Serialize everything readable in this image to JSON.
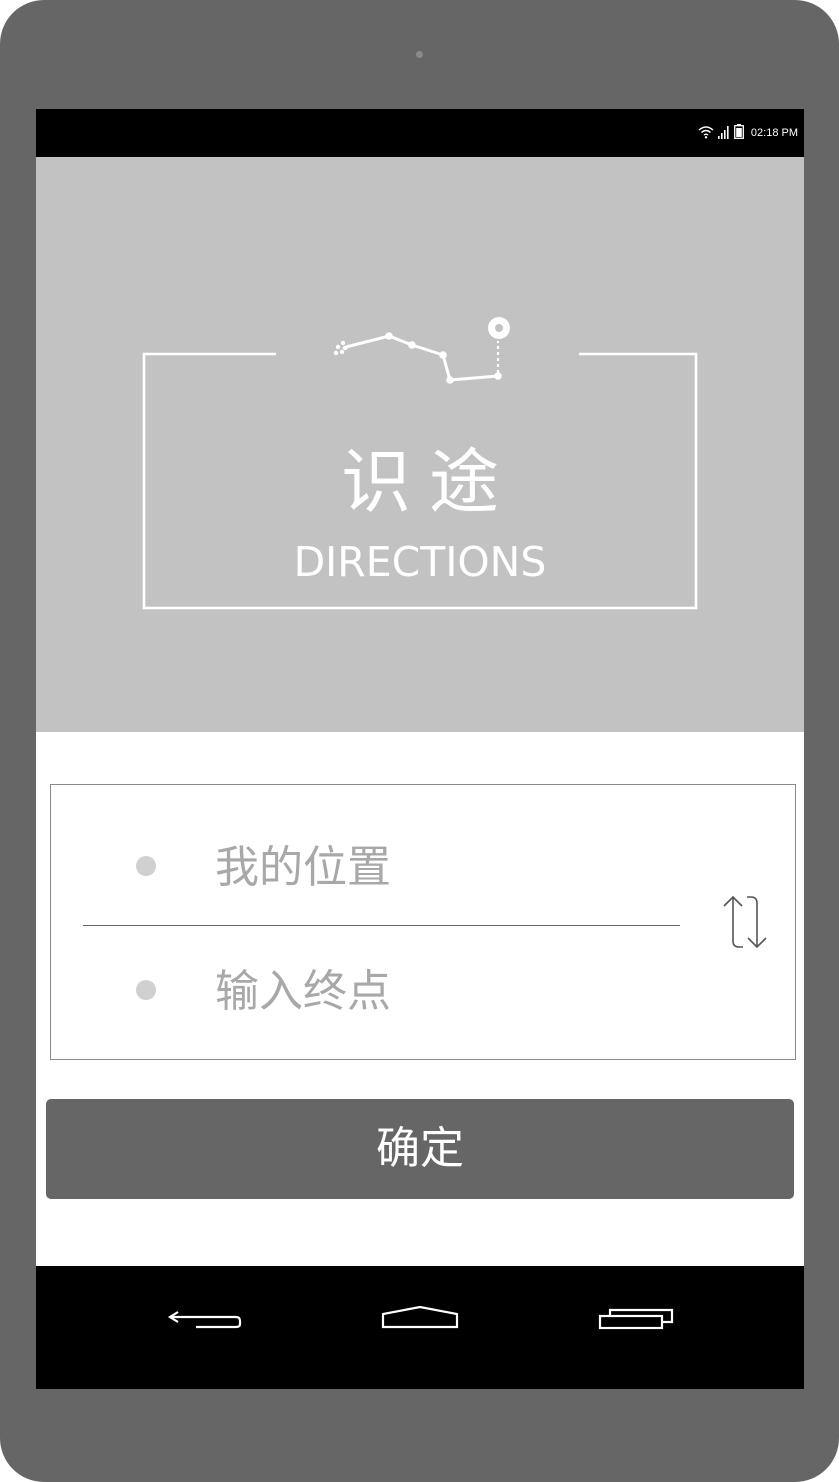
{
  "status_bar": {
    "time": "02:18 PM",
    "icons": [
      "wifi-icon",
      "signal-icon",
      "battery-icon"
    ]
  },
  "hero": {
    "title": "识途",
    "subtitle": "DIRECTIONS",
    "background_color": "#c2c2c2"
  },
  "route": {
    "start_placeholder": "我的位置",
    "end_placeholder": "输入终点",
    "swap_icon": "swap-arrows-icon"
  },
  "confirm": {
    "label": "确定"
  },
  "nav_bar": {
    "buttons": [
      "back-icon",
      "home-icon",
      "recents-icon"
    ]
  },
  "colors": {
    "device_frame": "#666666",
    "button": "#666666",
    "placeholder": "#a8a8a8"
  }
}
